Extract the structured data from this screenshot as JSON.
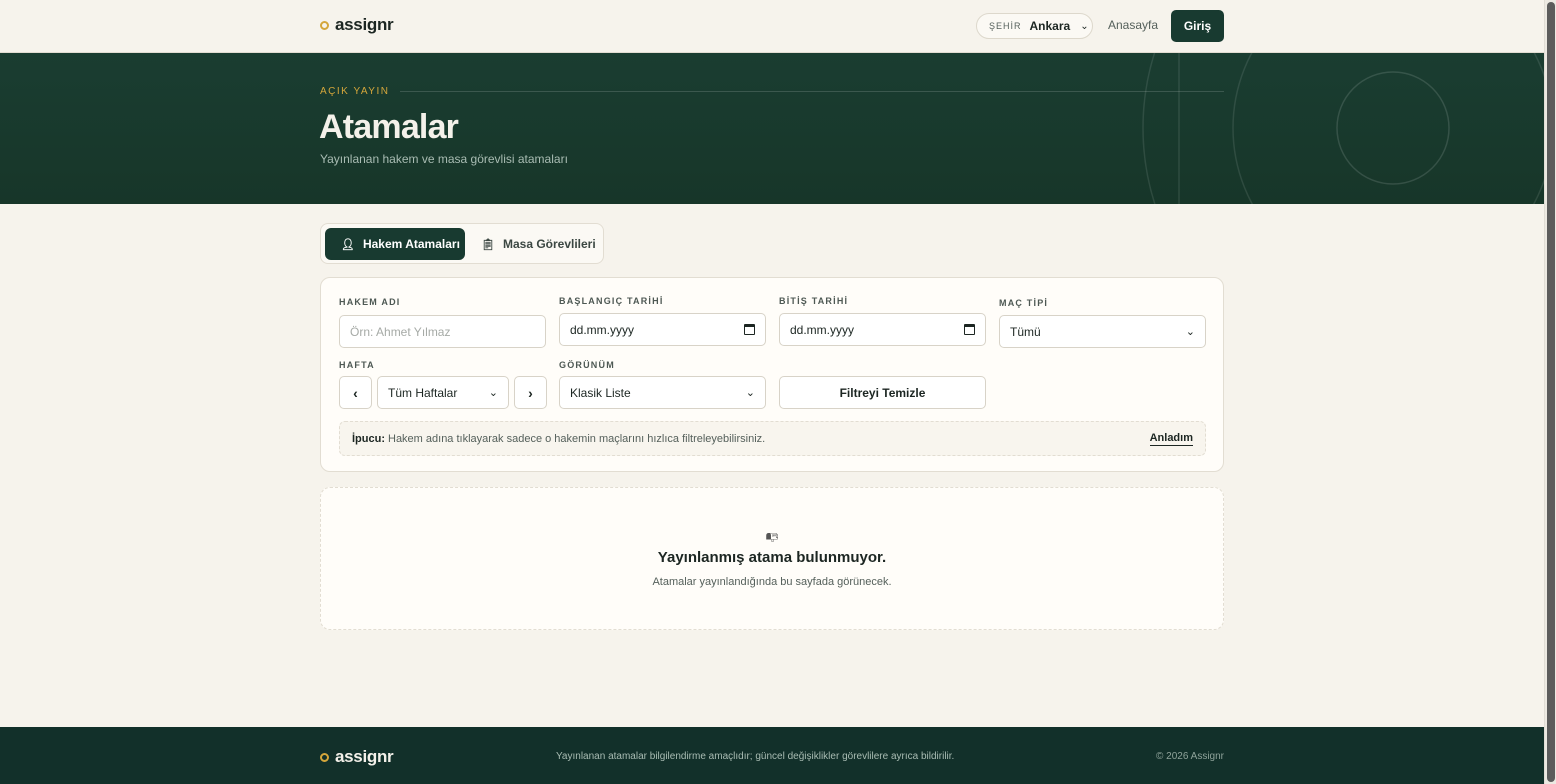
{
  "brand": {
    "name": "assignr",
    "accent": "#d4a63b",
    "primary": "#183a30"
  },
  "header": {
    "city_label": "ŞEHİR",
    "city_value": "Ankara",
    "home_link": "Anasayfa",
    "login_button": "Giriş"
  },
  "hero": {
    "eyebrow": "AÇIK YAYIN",
    "title": "Atamalar",
    "subtitle": "Yayınlanan hakem ve masa görevlisi atamaları"
  },
  "tabs": [
    {
      "label": "Hakem Atamaları",
      "icon": "person-icon",
      "active": true
    },
    {
      "label": "Masa Görevlileri",
      "icon": "clipboard-icon",
      "active": false
    }
  ],
  "filters": {
    "referee_label": "HAKEM ADI",
    "referee_placeholder": "Örn: Ahmet Yılmaz",
    "start_label": "BAŞLANGIÇ TARİHİ",
    "start_value": "dd.mm.yyyy",
    "end_label": "BİTİŞ TARİHİ",
    "end_value": "dd.mm.yyyy",
    "match_type_label": "MAÇ TİPİ",
    "match_type_value": "Tümü",
    "week_label": "HAFTA",
    "week_prev": "‹",
    "week_value": "Tüm Haftalar",
    "week_next": "›",
    "view_label": "GÖRÜNÜM",
    "view_value": "Klasik Liste",
    "clear_button": "Filtreyi Temizle"
  },
  "tip": {
    "prefix": "İpucu:",
    "text": "Hakem adına tıklayarak sadece o hakemin maçlarını hızlıca filtreleyebilirsiniz.",
    "dismiss": "Anladım"
  },
  "empty_state": {
    "icon": "inbox-icon",
    "title": "Yayınlanmış atama bulunmuyor.",
    "subtitle": "Atamalar yayınlandığında bu sayfada görünecek."
  },
  "footer": {
    "note": "Yayınlanan atamalar bilgilendirme amaçlıdır; güncel değişiklikler görevlilere ayrıca bildirilir.",
    "copyright": "© 2026 Assignr"
  }
}
